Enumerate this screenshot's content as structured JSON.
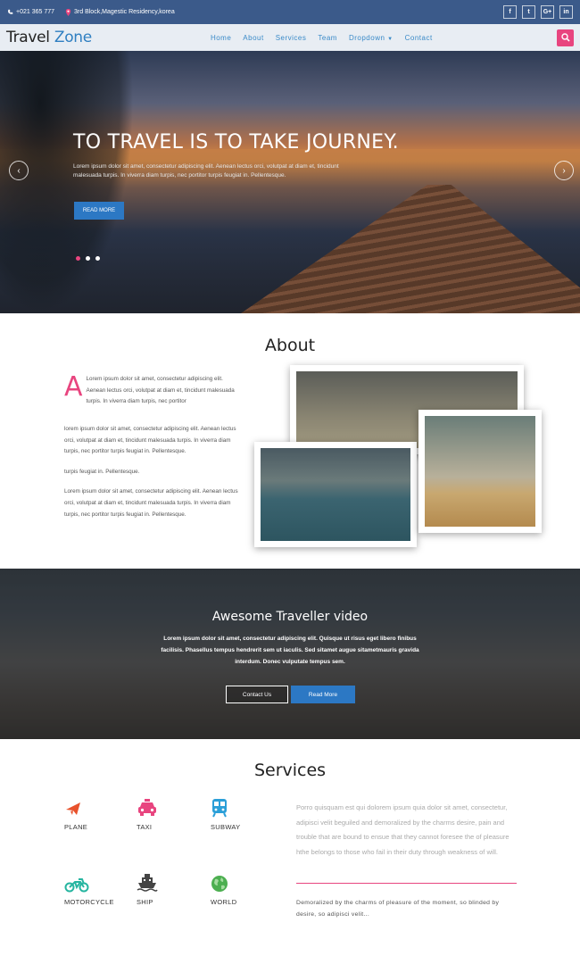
{
  "topbar": {
    "phone": "+021 365 777",
    "address": "3rd Block,Magestic Residency,korea",
    "social": [
      "f",
      "t",
      "G+",
      "in"
    ]
  },
  "nav": {
    "logo_part1": "Travel",
    "logo_part2": "Zone",
    "items": [
      "Home",
      "About",
      "Services",
      "Team",
      "Dropdown",
      "Contact"
    ]
  },
  "hero": {
    "title": "TO TRAVEL IS TO TAKE JOURNEY.",
    "subtitle": "Lorem ipsum dolor sit amet, consectetur adipiscing elit. Aenean lectus orci, volutpat at diam et, tincidunt malesuada turpis. In viverra diam turpis, nec portitor turpis feugiat in. Pellentesque.",
    "button": "READ MORE",
    "prev": "‹",
    "next": "›"
  },
  "about": {
    "title": "About",
    "dropcap": "A",
    "p1": "Lorem ipsum dolor sit amet, consectetur adipiscing elit. Aenean lectus orci, volutpat at diam et, tincidunt malesuada turpis. In viverra diam turpis, nec portitor",
    "p2": "lorem ipsum dolor sit amet, consectetur adipiscing elit. Aenean lectus orci, volutpat at diam et, tincidunt malesuada turpis. In viverra diam turpis, nec portitor turpis feugiat in. Pellentesque.",
    "p3": "turpis feugiat in. Pellentesque.",
    "p4": "Lorem ipsum dolor sit amet, consectetur adipiscing elit. Aenean lectus orci, volutpat at diam et, tincidunt malesuada turpis. In viverra diam turpis, nec portitor turpis feugiat in. Pellentesque."
  },
  "video": {
    "title": "Awesome Traveller video",
    "text": "Lorem ipsum dolor sit amet, consectetur adipiscing elit. Quisque ut risus eget libero finibus facilisis. Phasellus tempus hendrerit sem ut iaculis. Sed sitamet augue sitametmauris gravida interdum. Donec vulputate tempus sem.",
    "button1": "Contact Us",
    "button2": "Read More"
  },
  "services": {
    "title": "Services",
    "items": [
      {
        "label": "PLANE",
        "icon": "plane-icon",
        "color": "#e8522c"
      },
      {
        "label": "TAXI",
        "icon": "taxi-icon",
        "color": "#e8457f"
      },
      {
        "label": "SUBWAY",
        "icon": "subway-icon",
        "color": "#2b9fd8"
      },
      {
        "label": "MOTORCYCLE",
        "icon": "motorcycle-icon",
        "color": "#26b5a0"
      },
      {
        "label": "SHIP",
        "icon": "ship-icon",
        "color": "#444444"
      },
      {
        "label": "WORLD",
        "icon": "world-icon",
        "color": "#4caf50"
      }
    ],
    "text": "Porro quisquam est qui dolorem ipsum quia dolor sit amet, consectetur, adipisci velit beguiled and demoralized by the charms desire, pain and trouble that are bound to ensue that they cannot foresee the of pleasure hthe belongs to those who fail in their duty through weakness of will.",
    "text2": "Demoralized by the charms of pleasure of the moment, so blinded by desire, so adipisci velit..."
  },
  "colors": {
    "accent": "#e8457f",
    "primary": "#2c78c4",
    "topbar": "#3b5a8a"
  }
}
